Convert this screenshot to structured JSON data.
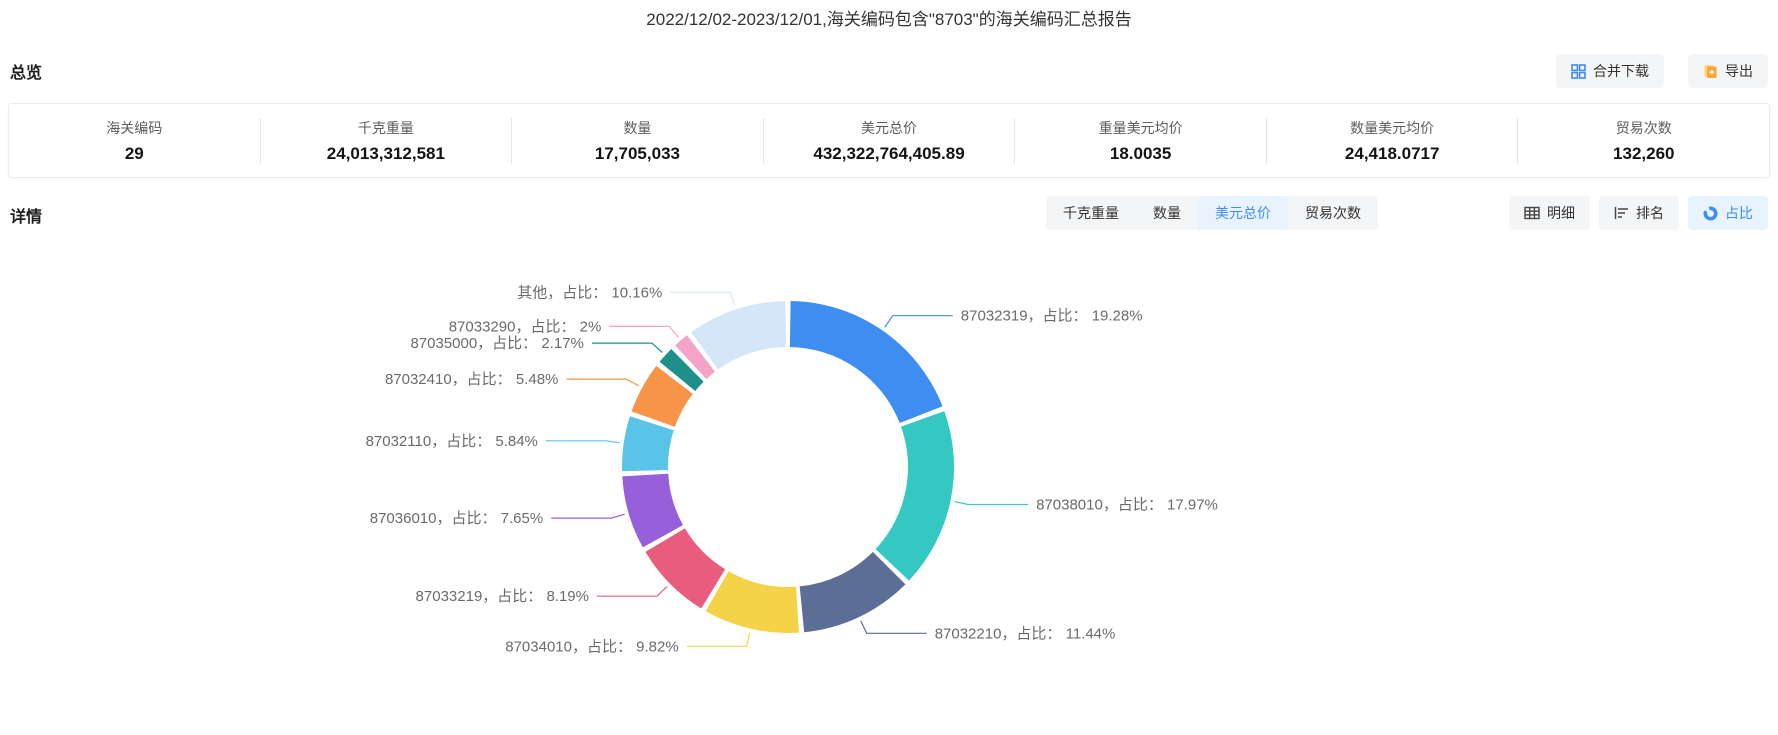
{
  "title": "2022/12/02-2023/12/01,海关编码包含\"8703\"的海关编码汇总报告",
  "overview": {
    "section_label": "总览",
    "buttons": {
      "merge_download": "合并下载",
      "export": "导出"
    },
    "stats": [
      {
        "label": "海关编码",
        "value": "29"
      },
      {
        "label": "千克重量",
        "value": "24,013,312,581"
      },
      {
        "label": "数量",
        "value": "17,705,033"
      },
      {
        "label": "美元总价",
        "value": "432,322,764,405.89"
      },
      {
        "label": "重量美元均价",
        "value": "18.0035"
      },
      {
        "label": "数量美元均价",
        "value": "24,418.0717"
      },
      {
        "label": "贸易次数",
        "value": "132,260"
      }
    ]
  },
  "detail": {
    "section_label": "详情",
    "metric_tabs": [
      {
        "label": "千克重量",
        "active": false
      },
      {
        "label": "数量",
        "active": false
      },
      {
        "label": "美元总价",
        "active": true
      },
      {
        "label": "贸易次数",
        "active": false
      }
    ],
    "view_tabs": [
      {
        "label": "明细",
        "icon": "table-icon",
        "active": false
      },
      {
        "label": "排名",
        "icon": "ranking-icon",
        "active": false
      },
      {
        "label": "占比",
        "icon": "donut-icon",
        "active": true
      }
    ]
  },
  "colors": {
    "accent": "#3d8ef0",
    "tab_active_bg": "#e8f3fe",
    "tab_bg": "#f4f5f7",
    "label_text": "#6b6b6b",
    "export_icon": "#f7a53c"
  },
  "chart_data": {
    "type": "pie",
    "donut": true,
    "label_format": "{name}，占比： {percent}",
    "legend_position": "none",
    "items": [
      {
        "name": "87032319",
        "value": 19.28,
        "percent_label": "19.28%",
        "color": "#3d8ef0"
      },
      {
        "name": "87038010",
        "value": 17.97,
        "percent_label": "17.97%",
        "color": "#35c8c2"
      },
      {
        "name": "87032210",
        "value": 11.44,
        "percent_label": "11.44%",
        "color": "#5b6e96"
      },
      {
        "name": "87034010",
        "value": 9.82,
        "percent_label": "9.82%",
        "color": "#f5d349"
      },
      {
        "name": "87033219",
        "value": 8.19,
        "percent_label": "8.19%",
        "color": "#e85c7e"
      },
      {
        "name": "87036010",
        "value": 7.65,
        "percent_label": "7.65%",
        "color": "#9660db"
      },
      {
        "name": "87032110",
        "value": 5.84,
        "percent_label": "5.84%",
        "color": "#5ac3e8"
      },
      {
        "name": "87032410",
        "value": 5.48,
        "percent_label": "5.48%",
        "color": "#f79447"
      },
      {
        "name": "87035000",
        "value": 2.17,
        "percent_label": "2.17%",
        "color": "#1f8f89"
      },
      {
        "name": "87033290",
        "value": 2,
        "percent_label": "2%",
        "color": "#f5a3c7"
      },
      {
        "name": "其他",
        "value": 10.16,
        "percent_label": "10.16%",
        "color": "#d5e6f8"
      }
    ]
  }
}
